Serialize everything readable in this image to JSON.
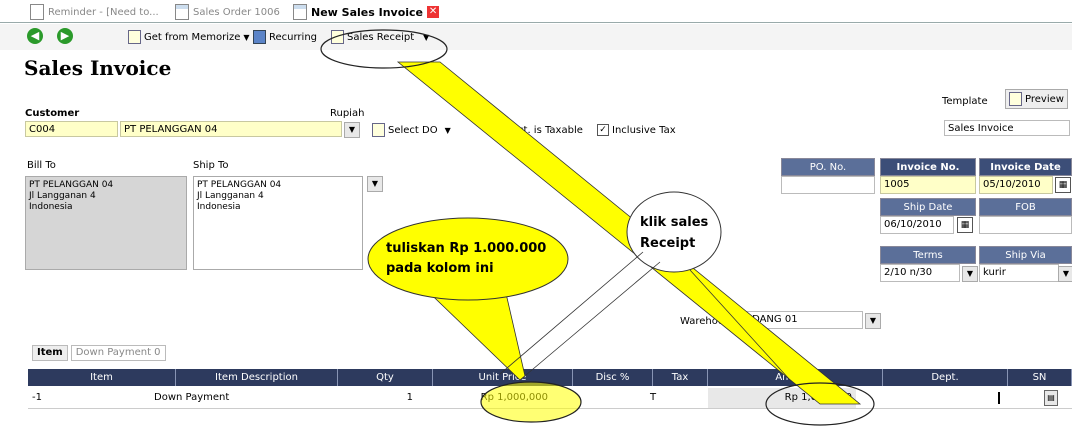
{
  "tabs": [
    {
      "label": "Reminder - [Need to..."
    },
    {
      "label": "Sales Order 1006"
    },
    {
      "label": "New Sales Invoice"
    }
  ],
  "toolbar": {
    "memorize_label": "Get from Memorize",
    "recurring_label": "Recurring",
    "sales_receipt_label": "Sales Receipt"
  },
  "header": {
    "title": "Sales Invoice",
    "customer_label": "Customer",
    "currency_label": "Rupiah",
    "customer_code": "C004",
    "customer_name": "PT PELANGGAN 04",
    "select_do_label": "Select DO",
    "cust_taxable_label": "Cust. is Taxable",
    "inclusive_tax_label": "Inclusive Tax",
    "template_label": "Template",
    "template_value": "Sales Invoice",
    "preview_label": "Preview"
  },
  "address": {
    "bill_to_label": "Bill To",
    "ship_to_label": "Ship To",
    "bill_to_text": "PT PELANGGAN 04\nJl Langganan 4\nIndonesia",
    "ship_to_text": "PT PELANGGAN 04\nJl Langganan 4\nIndonesia"
  },
  "invoice_info": {
    "po_no_label": "PO. No.",
    "po_no_value": "",
    "invoice_no_label": "Invoice No.",
    "invoice_no_value": "1005",
    "invoice_date_label": "Invoice Date",
    "invoice_date_value": "05/10/2010",
    "ship_date_label": "Ship Date",
    "ship_date_value": "06/10/2010",
    "fob_label": "FOB",
    "fob_value": "",
    "terms_label": "Terms",
    "terms_value": "2/10 n/30",
    "ship_via_label": "Ship Via",
    "ship_via_value": "kurir"
  },
  "warehouse": {
    "label": "Warehouse",
    "value": "GUDANG 01"
  },
  "subtabs": {
    "item_label": "Item",
    "down_payment_label": "Down Payment 0"
  },
  "grid": {
    "columns": [
      "Item",
      "Item Description",
      "Qty",
      "Unit Price",
      "Disc %",
      "Tax",
      "Amount",
      "Dept.",
      "SN"
    ],
    "rows": [
      {
        "item": "-1",
        "description": "Down Payment",
        "qty": "1",
        "unit_price": "Rp 1,000,000",
        "disc": "",
        "tax": "T",
        "amount": "Rp 1,000,000",
        "dept": "",
        "sn": ""
      }
    ]
  },
  "annotations": {
    "fill_note": "tuliskan Rp 1.000.000\npada kolom ini",
    "click_note": "klik sales\nReceipt"
  },
  "colors": {
    "header_navy": "#3c4e78",
    "input_yellow": "#ffffc8",
    "annotation_yellow": "#ffff00",
    "close_red": "#e33333"
  }
}
